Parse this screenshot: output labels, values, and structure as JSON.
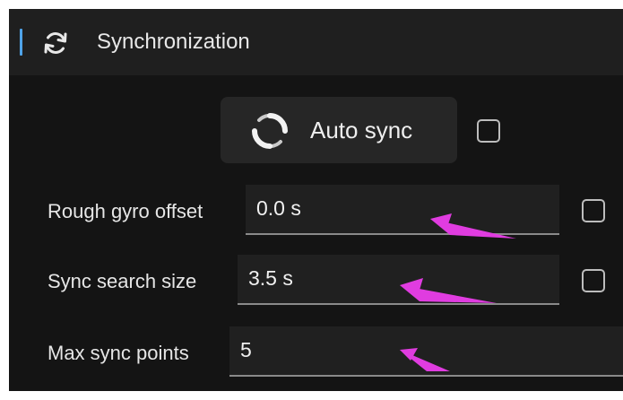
{
  "section": {
    "title": "Synchronization",
    "icon": "refresh-icon",
    "accent_color": "#4fa3e8"
  },
  "auto_sync": {
    "label": "Auto sync",
    "icon": "sync-spinner-icon",
    "checked": false
  },
  "fields": [
    {
      "label": "Rough gyro offset",
      "value": "0.0 s",
      "checked": false
    },
    {
      "label": "Sync search size",
      "value": "3.5 s",
      "checked": false
    },
    {
      "label": "Max sync points",
      "value": "5"
    }
  ],
  "annotation_color": "#e03ce0"
}
